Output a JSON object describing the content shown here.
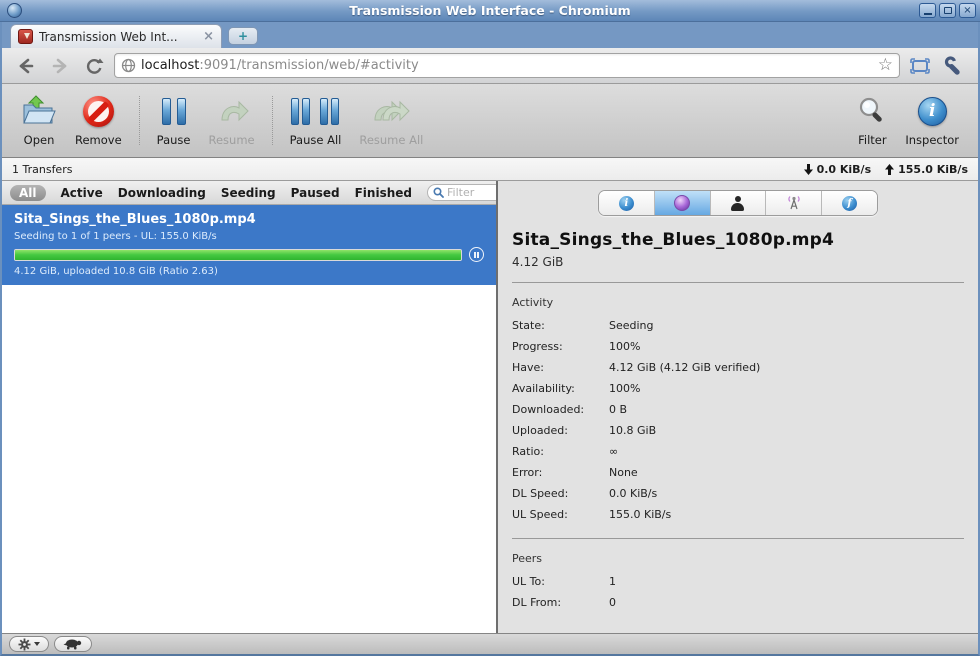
{
  "window": {
    "title": "Transmission Web Interface - Chromium"
  },
  "browser": {
    "tab_title": "Transmission Web Int...",
    "new_tab_label": "+",
    "url_host": "localhost",
    "url_rest": ":9091/transmission/web/#activity"
  },
  "toolbar": {
    "open_label": "Open",
    "remove_label": "Remove",
    "pause_label": "Pause",
    "resume_label": "Resume",
    "pause_all_label": "Pause All",
    "resume_all_label": "Resume All",
    "filter_label": "Filter",
    "inspector_label": "Inspector"
  },
  "statusbar": {
    "transfers": "1 Transfers",
    "down_speed": "0.0 KiB/s",
    "up_speed": "155.0 KiB/s"
  },
  "filterbar": {
    "tabs": [
      {
        "label": "All",
        "selected": true
      },
      {
        "label": "Active",
        "selected": false
      },
      {
        "label": "Downloading",
        "selected": false
      },
      {
        "label": "Seeding",
        "selected": false
      },
      {
        "label": "Paused",
        "selected": false
      },
      {
        "label": "Finished",
        "selected": false
      }
    ],
    "search_placeholder": "Filter"
  },
  "torrent": {
    "name": "Sita_Sings_the_Blues_1080p.mp4",
    "peers_line": "Seeding to 1 of 1 peers - UL: 155.0 KiB/s",
    "progress_percent": 100,
    "stats_line": "4.12 GiB, uploaded 10.8 GiB (Ratio 2.63)"
  },
  "inspector": {
    "title": "Sita_Sings_the_Blues_1080p.mp4",
    "size": "4.12 GiB",
    "activity_header": "Activity",
    "activity_rows": [
      {
        "label": "State:",
        "value": "Seeding"
      },
      {
        "label": "Progress:",
        "value": "100%"
      },
      {
        "label": "Have:",
        "value": "4.12 GiB (4.12 GiB verified)"
      },
      {
        "label": "Availability:",
        "value": "100%"
      },
      {
        "label": "Downloaded:",
        "value": "0 B"
      },
      {
        "label": "Uploaded:",
        "value": "10.8 GiB"
      },
      {
        "label": "Ratio:",
        "value": "∞"
      },
      {
        "label": "Error:",
        "value": "None"
      },
      {
        "label": "DL Speed:",
        "value": "0.0 KiB/s"
      },
      {
        "label": "UL Speed:",
        "value": "155.0 KiB/s"
      }
    ],
    "peers_header": "Peers",
    "peers_rows": [
      {
        "label": "UL To:",
        "value": "1"
      },
      {
        "label": "DL From:",
        "value": "0"
      }
    ]
  },
  "colors": {
    "titlebar_blue": "#7499c4",
    "selection_blue": "#3c78c8",
    "progress_green": "#45c841",
    "selected_tab_blue": "#66a8e2"
  }
}
